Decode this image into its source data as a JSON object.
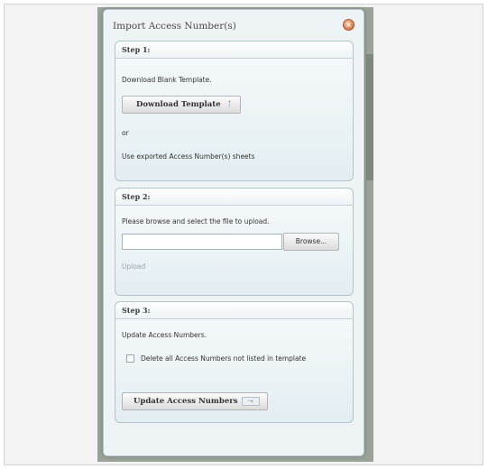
{
  "dialog": {
    "title": "Import Access Number(s)",
    "close_icon": "close-icon"
  },
  "step1": {
    "header": "Step 1:",
    "instruction": "Download Blank Template.",
    "download_button": "Download Template",
    "download_icon": "upload-arrow-icon",
    "or_text": "or",
    "alt_text": "Use exported Access Number(s) sheets"
  },
  "step2": {
    "header": "Step 2:",
    "instruction": "Please browse and select the file to upload.",
    "file_value": "",
    "browse_button": "Browse...",
    "upload_link": "Upload"
  },
  "step3": {
    "header": "Step 3:",
    "instruction": "Update Access Numbers.",
    "checkbox_label": "Delete all Access Numbers not listed in template",
    "checkbox_checked": false,
    "update_button": "Update Access Numbers",
    "update_icon": "import-icon"
  },
  "colors": {
    "dialog_bg": "#eef3f5",
    "step_border": "#b2c4cc",
    "close_button": "#d9774a",
    "disabled_link": "#9aa6ad"
  }
}
